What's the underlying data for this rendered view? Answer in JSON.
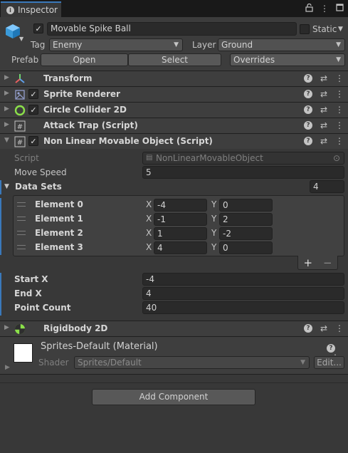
{
  "tab": {
    "title": "Inspector"
  },
  "gameobject": {
    "active": true,
    "name": "Movable Spike Ball",
    "static_label": "Static",
    "static_checked": false,
    "tag_label": "Tag",
    "tag_value": "Enemy",
    "layer_label": "Layer",
    "layer_value": "Ground",
    "prefab_label": "Prefab",
    "open_label": "Open",
    "select_label": "Select",
    "overrides_label": "Overrides"
  },
  "components": {
    "transform": "Transform",
    "sprite_renderer": "Sprite Renderer",
    "circle_collider": "Circle Collider 2D",
    "attack_trap": "Attack Trap (Script)",
    "nonlinear": "Non Linear Movable Object (Script)",
    "rigidbody": "Rigidbody 2D"
  },
  "script_fields": {
    "script_label": "Script",
    "script_value": "NonLinearMovableObject",
    "move_speed_label": "Move Speed",
    "move_speed_value": "5",
    "data_sets_label": "Data Sets",
    "data_sets_count": "4",
    "elements": [
      {
        "label": "Element 0",
        "x": "-4",
        "y": "0"
      },
      {
        "label": "Element 1",
        "x": "-1",
        "y": "2"
      },
      {
        "label": "Element 2",
        "x": "1",
        "y": "-2"
      },
      {
        "label": "Element 3",
        "x": "4",
        "y": "0"
      }
    ],
    "x_label": "X",
    "y_label": "Y",
    "add_label": "+",
    "remove_label": "−",
    "start_x_label": "Start X",
    "start_x_value": "-4",
    "end_x_label": "End X",
    "end_x_value": "4",
    "point_count_label": "Point Count",
    "point_count_value": "40"
  },
  "material": {
    "name": "Sprites-Default (Material)",
    "shader_label": "Shader",
    "shader_value": "Sprites/Default",
    "edit_label": "Edit..."
  },
  "add_component_label": "Add Component",
  "colors": {
    "accent": "#3a79bb",
    "panel": "#383838",
    "header": "#3e3e3e"
  }
}
